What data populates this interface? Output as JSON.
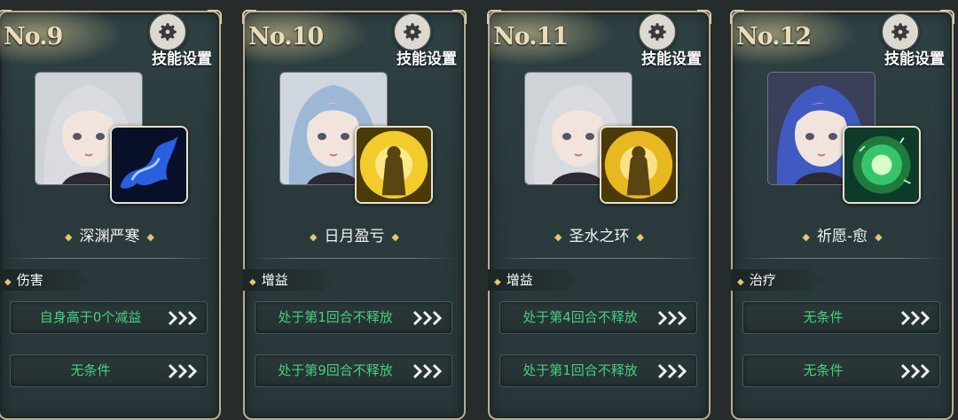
{
  "header": {
    "skill_settings_label": "技能设置"
  },
  "cards": [
    {
      "number": "No.9",
      "skill_name": "深渊严寒",
      "type": "伤害",
      "conditions": [
        "自身高于0个减益",
        "无条件"
      ],
      "skill_color": "#2a5fe0",
      "portrait_hair": "#d9dbe0"
    },
    {
      "number": "No.10",
      "skill_name": "日月盈亏",
      "type": "增益",
      "conditions": [
        "处于第1回合不释放",
        "处于第9回合不释放"
      ],
      "skill_color": "#f2cc2a",
      "portrait_hair": "#9db8d6"
    },
    {
      "number": "No.11",
      "skill_name": "圣水之环",
      "type": "增益",
      "conditions": [
        "处于第4回合不释放",
        "处于第1回合不释放"
      ],
      "skill_color": "#e8b820",
      "portrait_hair": "#d9dbe0"
    },
    {
      "number": "No.12",
      "skill_name": "祈愿-愈",
      "type": "治疗",
      "conditions": [
        "无条件",
        "无条件"
      ],
      "skill_color": "#36c56a",
      "portrait_hair": "#3f5bc2"
    }
  ],
  "colors": {
    "condition_text": "#45d07a",
    "frame": "#b9ac8f",
    "star": "#e4c86a"
  },
  "icons": [
    "gear-icon",
    "chevron-triple-icon",
    "star-icon"
  ]
}
